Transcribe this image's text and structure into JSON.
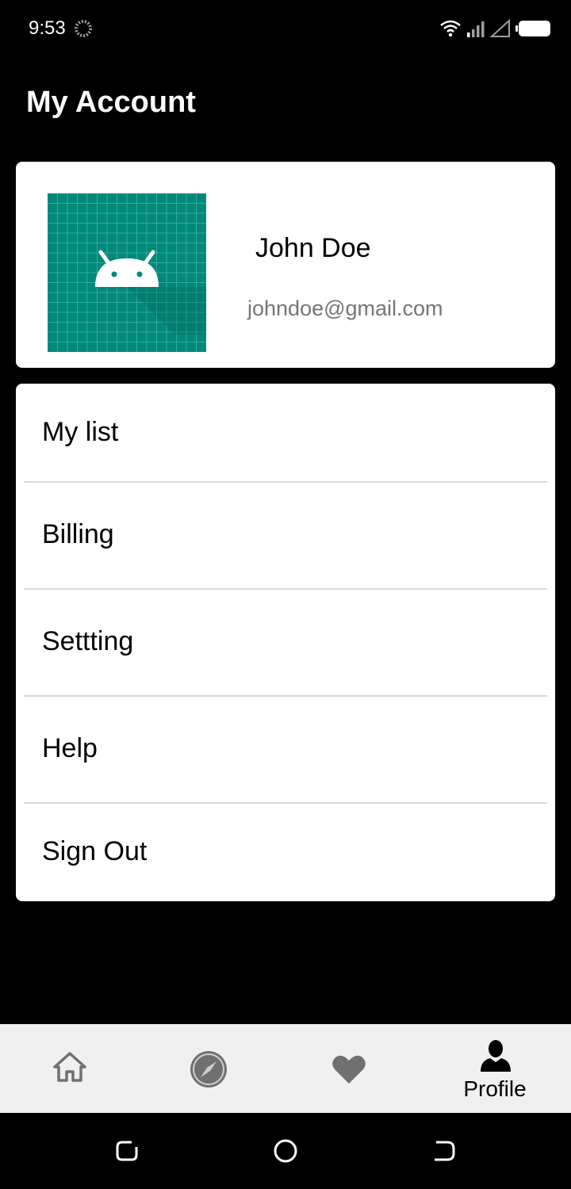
{
  "status_bar": {
    "time": "9:53",
    "icons": [
      "loading-spinner-icon",
      "wifi-icon",
      "signal-icon",
      "signal-empty-icon",
      "battery-icon"
    ]
  },
  "header": {
    "title": "My Account"
  },
  "profile": {
    "name": "John Doe",
    "email": "johndoe@gmail.com",
    "avatar_icon": "android-icon",
    "avatar_color": "#00897B"
  },
  "menu": {
    "items": [
      {
        "label": "My list"
      },
      {
        "label": "Billing"
      },
      {
        "label": "Settting"
      },
      {
        "label": "Help"
      },
      {
        "label": "Sign Out"
      }
    ]
  },
  "bottom_nav": {
    "items": [
      {
        "icon": "home-icon",
        "label": ""
      },
      {
        "icon": "compass-icon",
        "label": ""
      },
      {
        "icon": "heart-icon",
        "label": ""
      },
      {
        "icon": "person-icon",
        "label": "Profile",
        "active": true
      }
    ]
  },
  "system_nav": {
    "buttons": [
      "recents-icon",
      "home-circle-icon",
      "back-icon"
    ]
  },
  "colors": {
    "background": "#000000",
    "card": "#FFFFFF",
    "nav_background": "#F0F0F0",
    "inactive_icon": "#707070",
    "email_text": "#757575"
  }
}
